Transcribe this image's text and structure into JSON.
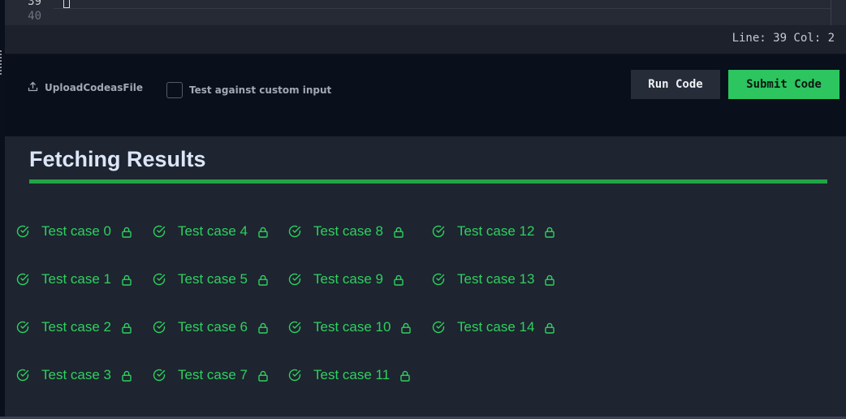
{
  "editor": {
    "line_numbers": [
      "39",
      "40"
    ],
    "status": "Line: 39 Col: 2"
  },
  "toolbar": {
    "upload_label": "UploadCodeasFile",
    "custom_input_label": "Test against custom input",
    "run_label": "Run Code",
    "submit_label": "Submit Code"
  },
  "results": {
    "title": "Fetching Results",
    "progress": 1.0,
    "test_cases": [
      {
        "label": "Test case 0",
        "status": "passed",
        "locked": true
      },
      {
        "label": "Test case 1",
        "status": "passed",
        "locked": true
      },
      {
        "label": "Test case 2",
        "status": "passed",
        "locked": true
      },
      {
        "label": "Test case 3",
        "status": "passed",
        "locked": true
      },
      {
        "label": "Test case 4",
        "status": "passed",
        "locked": true
      },
      {
        "label": "Test case 5",
        "status": "passed",
        "locked": true
      },
      {
        "label": "Test case 6",
        "status": "passed",
        "locked": true
      },
      {
        "label": "Test case 7",
        "status": "passed",
        "locked": true
      },
      {
        "label": "Test case 8",
        "status": "passed",
        "locked": true
      },
      {
        "label": "Test case 9",
        "status": "passed",
        "locked": true
      },
      {
        "label": "Test case 10",
        "status": "passed",
        "locked": true
      },
      {
        "label": "Test case 11",
        "status": "passed",
        "locked": true
      },
      {
        "label": "Test case 12",
        "status": "passed",
        "locked": true
      },
      {
        "label": "Test case 13",
        "status": "passed",
        "locked": true
      },
      {
        "label": "Test case 14",
        "status": "passed",
        "locked": true
      }
    ]
  },
  "icons": {
    "upload": "upload-icon",
    "check": "check-circle-icon",
    "lock": "lock-icon"
  },
  "colors": {
    "accent_green": "#2cc560",
    "progress_green": "#22a544",
    "pass_text": "#2ed15e",
    "title_text": "#dbe6f7"
  }
}
